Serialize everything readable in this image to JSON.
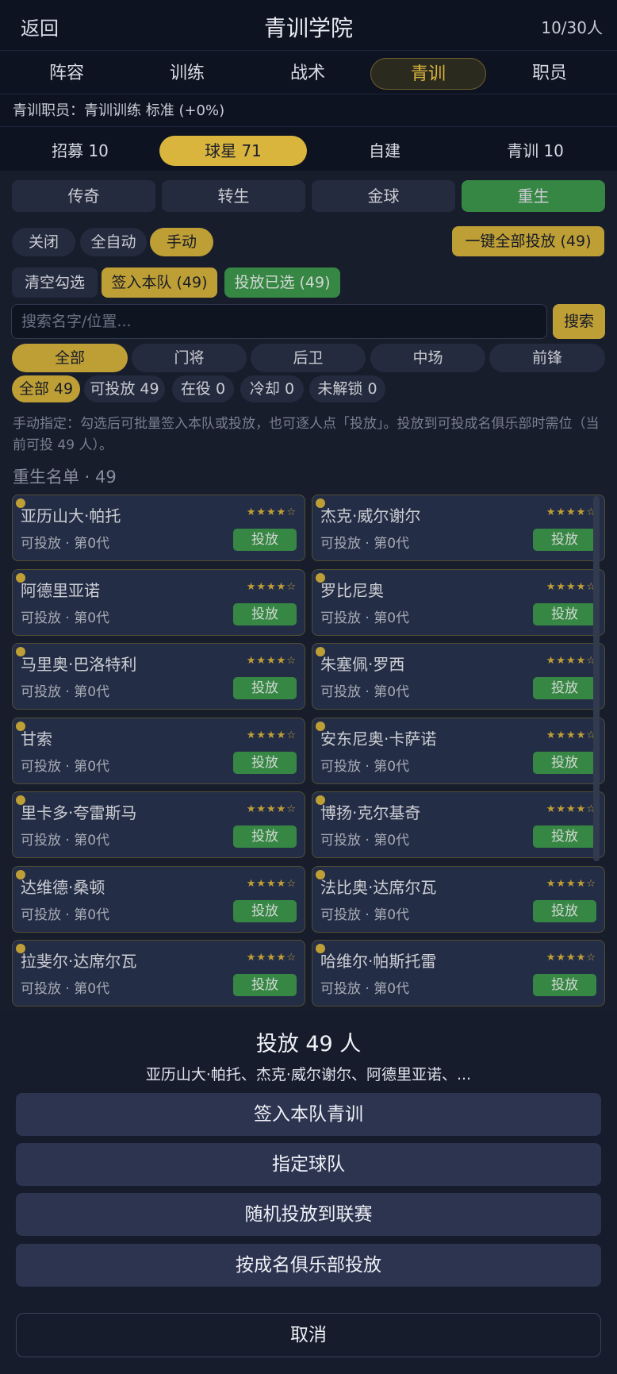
{
  "header": {
    "back_label": "返回",
    "title": "青训学院",
    "count": "10/30人"
  },
  "main_tabs": [
    {
      "label": "阵容"
    },
    {
      "label": "训练"
    },
    {
      "label": "战术"
    },
    {
      "label": "青训"
    },
    {
      "label": "职员"
    }
  ],
  "staff_line": "青训职员：青训训练 标准 (+0%)",
  "sub_tabs": [
    {
      "label": "招募 10"
    },
    {
      "label": "球星 71"
    },
    {
      "label": "自建"
    },
    {
      "label": "青训 10"
    }
  ],
  "modes": [
    {
      "label": "传奇"
    },
    {
      "label": "转生"
    },
    {
      "label": "金球"
    },
    {
      "label": "重生"
    }
  ],
  "auto": {
    "off": "关闭",
    "full_auto": "全自动",
    "manual": "手动",
    "release_all": "一键全部投放 (49)"
  },
  "actions": {
    "clear": "清空勾选",
    "sign": "签入本队 (49)",
    "release_selected": "投放已选 (49)"
  },
  "search": {
    "placeholder": "搜索名字/位置...",
    "button": "搜索"
  },
  "positions": [
    {
      "label": "全部"
    },
    {
      "label": "门将"
    },
    {
      "label": "后卫"
    },
    {
      "label": "中场"
    },
    {
      "label": "前锋"
    }
  ],
  "status_filters": [
    {
      "label": "全部 49"
    },
    {
      "label": "可投放 49"
    },
    {
      "label": "在役 0"
    },
    {
      "label": "冷却 0"
    },
    {
      "label": "未解锁 0"
    }
  ],
  "hint": "手动指定：勾选后可批量签入本队或投放，也可逐人点「投放」。投放到可投成名俱乐部时需位（当前可投 49 人）。",
  "section_title": "重生名单 · 49",
  "players": [
    {
      "name": "亚历山大·帕托",
      "stars": "★★★★☆",
      "meta": "可投放 · 第0代",
      "action": "投放"
    },
    {
      "name": "杰克·威尔谢尔",
      "stars": "★★★★☆",
      "meta": "可投放 · 第0代",
      "action": "投放"
    },
    {
      "name": "阿德里亚诺",
      "stars": "★★★★☆",
      "meta": "可投放 · 第0代",
      "action": "投放"
    },
    {
      "name": "罗比尼奥",
      "stars": "★★★★☆",
      "meta": "可投放 · 第0代",
      "action": "投放"
    },
    {
      "name": "马里奥·巴洛特利",
      "stars": "★★★★☆",
      "meta": "可投放 · 第0代",
      "action": "投放"
    },
    {
      "name": "朱塞佩·罗西",
      "stars": "★★★★☆",
      "meta": "可投放 · 第0代",
      "action": "投放"
    },
    {
      "name": "甘索",
      "stars": "★★★★☆",
      "meta": "可投放 · 第0代",
      "action": "投放"
    },
    {
      "name": "安东尼奥·卡萨诺",
      "stars": "★★★★☆",
      "meta": "可投放 · 第0代",
      "action": "投放"
    },
    {
      "name": "里卡多·夸雷斯马",
      "stars": "★★★★☆",
      "meta": "可投放 · 第0代",
      "action": "投放"
    },
    {
      "name": "博扬·克尔基奇",
      "stars": "★★★★☆",
      "meta": "可投放 · 第0代",
      "action": "投放"
    },
    {
      "name": "达维德·桑顿",
      "stars": "★★★★☆",
      "meta": "可投放 · 第0代",
      "action": "投放"
    },
    {
      "name": "法比奥·达席尔瓦",
      "stars": "★★★★☆",
      "meta": "可投放 · 第0代",
      "action": "投放"
    },
    {
      "name": "拉斐尔·达席尔瓦",
      "stars": "★★★★☆",
      "meta": "可投放 · 第0代",
      "action": "投放"
    },
    {
      "name": "哈维尔·帕斯托雷",
      "stars": "★★★★☆",
      "meta": "可投放 · 第0代",
      "action": "投放"
    }
  ],
  "sheet": {
    "title": "投放 49 人",
    "subtitle": "亚历山大·帕托、杰克·威尔谢尔、阿德里亚诺、...",
    "options": [
      {
        "label": "签入本队青训"
      },
      {
        "label": "指定球队"
      },
      {
        "label": "随机投放到联赛"
      },
      {
        "label": "按成名俱乐部投放"
      }
    ],
    "cancel": "取消"
  },
  "colors": {
    "gold": "#d9b53e",
    "green": "#3e9a4e",
    "background": "#0f1424"
  }
}
